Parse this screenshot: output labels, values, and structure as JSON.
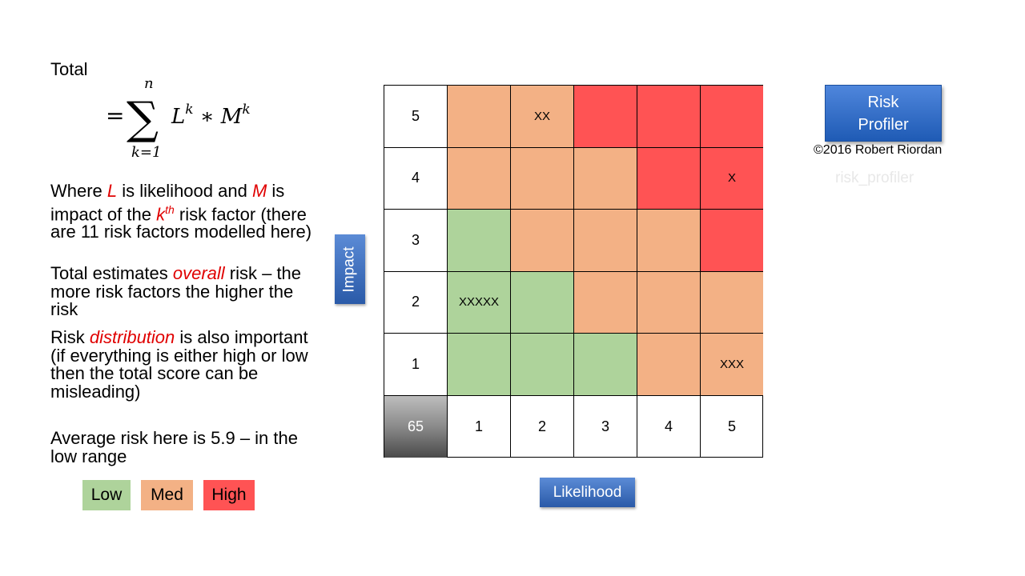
{
  "explanation": {
    "total_label": "Total",
    "formula": {
      "eq": "=",
      "sum_upper": "n",
      "sum_symbol": "∑",
      "sum_lower": "k=1",
      "term_l": "L",
      "term_sup_l": "k",
      "term_times": " ∗ ",
      "term_m": "M",
      "term_sup_m": "k"
    },
    "para1": {
      "t1": "Where ",
      "L": "L",
      "t2": " is likelihood and ",
      "M": "M",
      "t3": " is impact of the ",
      "k": "k",
      "th": "th",
      "t4": " risk factor (there are 11 risk factors modelled here)"
    },
    "para2": {
      "t1": "Total estimates ",
      "em": "overall",
      "t2": " risk – the more risk factors the higher the risk"
    },
    "para3": {
      "t1": "Risk ",
      "em": "distribution",
      "t2": " is also important (if everything is either high or low then the total score can be misleading)"
    },
    "para4": "Average risk here is 5.9 – in the low range"
  },
  "legend": [
    {
      "label": "Low",
      "color": "#aed39b"
    },
    {
      "label": "Med",
      "color": "#f3b185"
    },
    {
      "label": "High",
      "color": "#ff5354"
    }
  ],
  "matrix": {
    "colors": {
      "low": "#aed39b",
      "med": "#f3b185",
      "high": "#ff5354"
    },
    "rows": [
      {
        "impact": "5",
        "cells": [
          {
            "level": "med",
            "mark": ""
          },
          {
            "level": "med",
            "mark": "XX"
          },
          {
            "level": "high",
            "mark": ""
          },
          {
            "level": "high",
            "mark": ""
          },
          {
            "level": "high",
            "mark": ""
          }
        ]
      },
      {
        "impact": "4",
        "cells": [
          {
            "level": "med",
            "mark": ""
          },
          {
            "level": "med",
            "mark": ""
          },
          {
            "level": "med",
            "mark": ""
          },
          {
            "level": "high",
            "mark": ""
          },
          {
            "level": "high",
            "mark": "X"
          }
        ]
      },
      {
        "impact": "3",
        "cells": [
          {
            "level": "low",
            "mark": ""
          },
          {
            "level": "med",
            "mark": ""
          },
          {
            "level": "med",
            "mark": ""
          },
          {
            "level": "med",
            "mark": ""
          },
          {
            "level": "high",
            "mark": ""
          }
        ]
      },
      {
        "impact": "2",
        "cells": [
          {
            "level": "low",
            "mark": "XXXXX"
          },
          {
            "level": "low",
            "mark": ""
          },
          {
            "level": "med",
            "mark": ""
          },
          {
            "level": "med",
            "mark": ""
          },
          {
            "level": "med",
            "mark": ""
          }
        ]
      },
      {
        "impact": "1",
        "cells": [
          {
            "level": "low",
            "mark": ""
          },
          {
            "level": "low",
            "mark": ""
          },
          {
            "level": "low",
            "mark": ""
          },
          {
            "level": "med",
            "mark": ""
          },
          {
            "level": "med",
            "mark": "XXX"
          }
        ]
      }
    ],
    "total_score": "65",
    "likelihood_values": [
      "1",
      "2",
      "3",
      "4",
      "5"
    ]
  },
  "axes": {
    "impact_label": "Impact",
    "likelihood_label": "Likelihood"
  },
  "profiler": {
    "button_line1": "Risk",
    "button_line2": "Profiler",
    "copyright": "©2016 Robert Riordan",
    "watermark": "risk_profiler"
  }
}
